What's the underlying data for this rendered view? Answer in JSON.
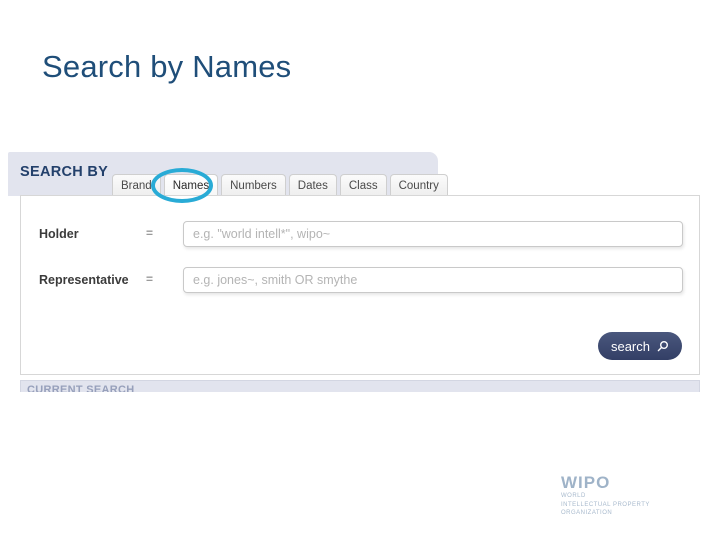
{
  "slide": {
    "title": "Search by Names",
    "title_color": "#1F4E79"
  },
  "screenshot": {
    "header": {
      "label": "SEARCH BY"
    },
    "tabs": [
      {
        "label": "Brand",
        "active": false
      },
      {
        "label": "Names",
        "active": true
      },
      {
        "label": "Numbers",
        "active": false
      },
      {
        "label": "Dates",
        "active": false
      },
      {
        "label": "Class",
        "active": false
      },
      {
        "label": "Country",
        "active": false
      }
    ],
    "highlight": {
      "target_tab": "Names",
      "color": "#29ABD6",
      "shape": "ellipse"
    },
    "fields": [
      {
        "label": "Holder",
        "operator": "=",
        "value": "",
        "placeholder": "e.g. \"world intell*\", wipo~"
      },
      {
        "label": "Representative",
        "operator": "=",
        "value": "",
        "placeholder": "e.g. jones~, smith OR smythe"
      }
    ],
    "search_button": {
      "label": "search",
      "icon": "magnifier-icon",
      "glyph": "⌕",
      "color": "#333f66"
    },
    "current_search": {
      "label": "CURRENT SEARCH"
    }
  },
  "footer": {
    "logo": {
      "mark": "WIPO",
      "line1": "WORLD",
      "line2": "INTELLECTUAL PROPERTY",
      "line3": "ORGANIZATION",
      "color": "#9fb3c8"
    }
  }
}
